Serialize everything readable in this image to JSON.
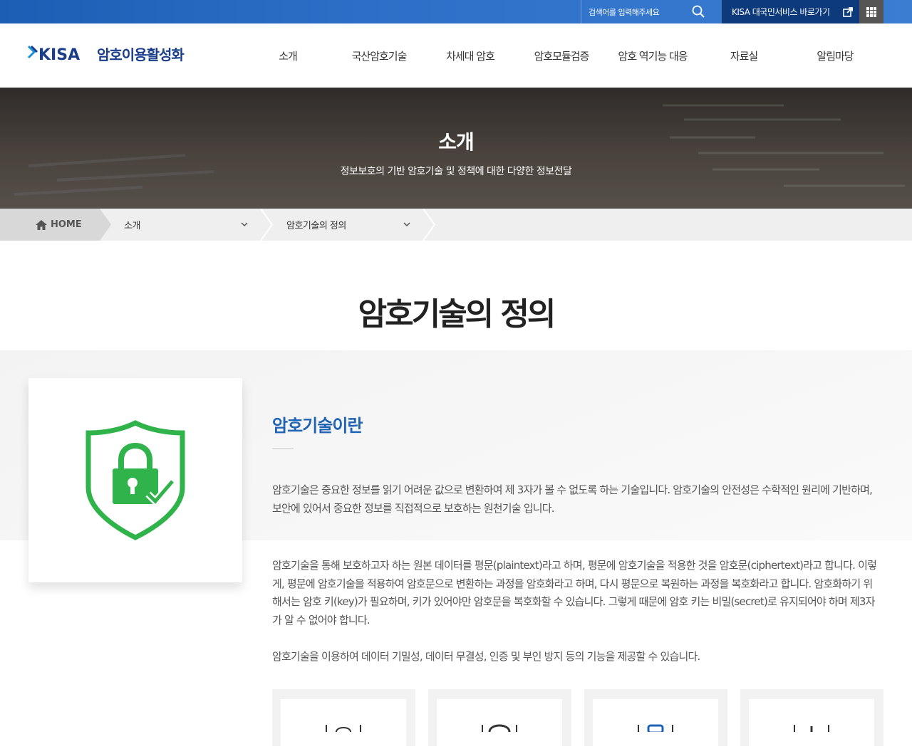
{
  "topbar": {
    "search_placeholder": "검색어를 입력해주세요",
    "kisa_link": "KISA 대국민서비스 바로가기"
  },
  "header": {
    "logo_text": "암호이용활성화",
    "nav": [
      "소개",
      "국산암호기술",
      "차세대 암호",
      "암호모듈검증",
      "암호 역기능 대응",
      "자료실",
      "알림마당"
    ]
  },
  "hero": {
    "title": "소개",
    "subtitle": "정보보호의 기반 암호기술 및 정책에 대한 다양한 정보전달"
  },
  "breadcrumb": {
    "home": "HOME",
    "level1": "소개",
    "level2": "암호기술의 정의"
  },
  "page": {
    "title": "암호기술의 정의",
    "section_title": "암호기술이란",
    "paragraphs": [
      "암호기술은 중요한 정보를 읽기 어려운 값으로 변환하여 제 3자가 볼 수 없도록 하는 기술입니다. 암호기술의 안전성은 수학적인 원리에 기반하며, 보안에 있어서 중요한 정보를 직접적으로 보호하는 원천기술 입니다.",
      "암호기술을 통해 보호하고자 하는 원본 데이터를 평문(plaintext)라고 하며, 평문에 암호기술을 적용한 것을 암호문(ciphertext)라고 합니다. 이렇게, 평문에 암호기술을 적용하여 암호문으로 변환하는 과정을 암호화라고 하며, 다시 평문으로 복원하는 과정을 복호화라고 합니다. 암호화하기 위해서는 암호 키(key)가 필요하며, 키가 있어야만 암호문을 복호화할 수 있습니다. 그렇게 때문에 암호 키는 비밀(secret)로 유지되어야 하며 제3자가 알 수 없어야 합니다.",
      "암호기술을 이용하여 데이터 기밀성, 데이터 무결성, 인증 및 부인 방지 등의 기능을 제공할 수 있습니다."
    ]
  },
  "colors": {
    "topbar": "#2c6fc8",
    "kisa_link_bg": "#0d3a7a",
    "accent": "#1f63b5",
    "shield_green": "#2fb34a"
  },
  "icons": [
    "search-icon",
    "external-link-icon",
    "grid-menu-icon",
    "home-icon",
    "chevron-down-icon",
    "shield-lock-icon"
  ]
}
